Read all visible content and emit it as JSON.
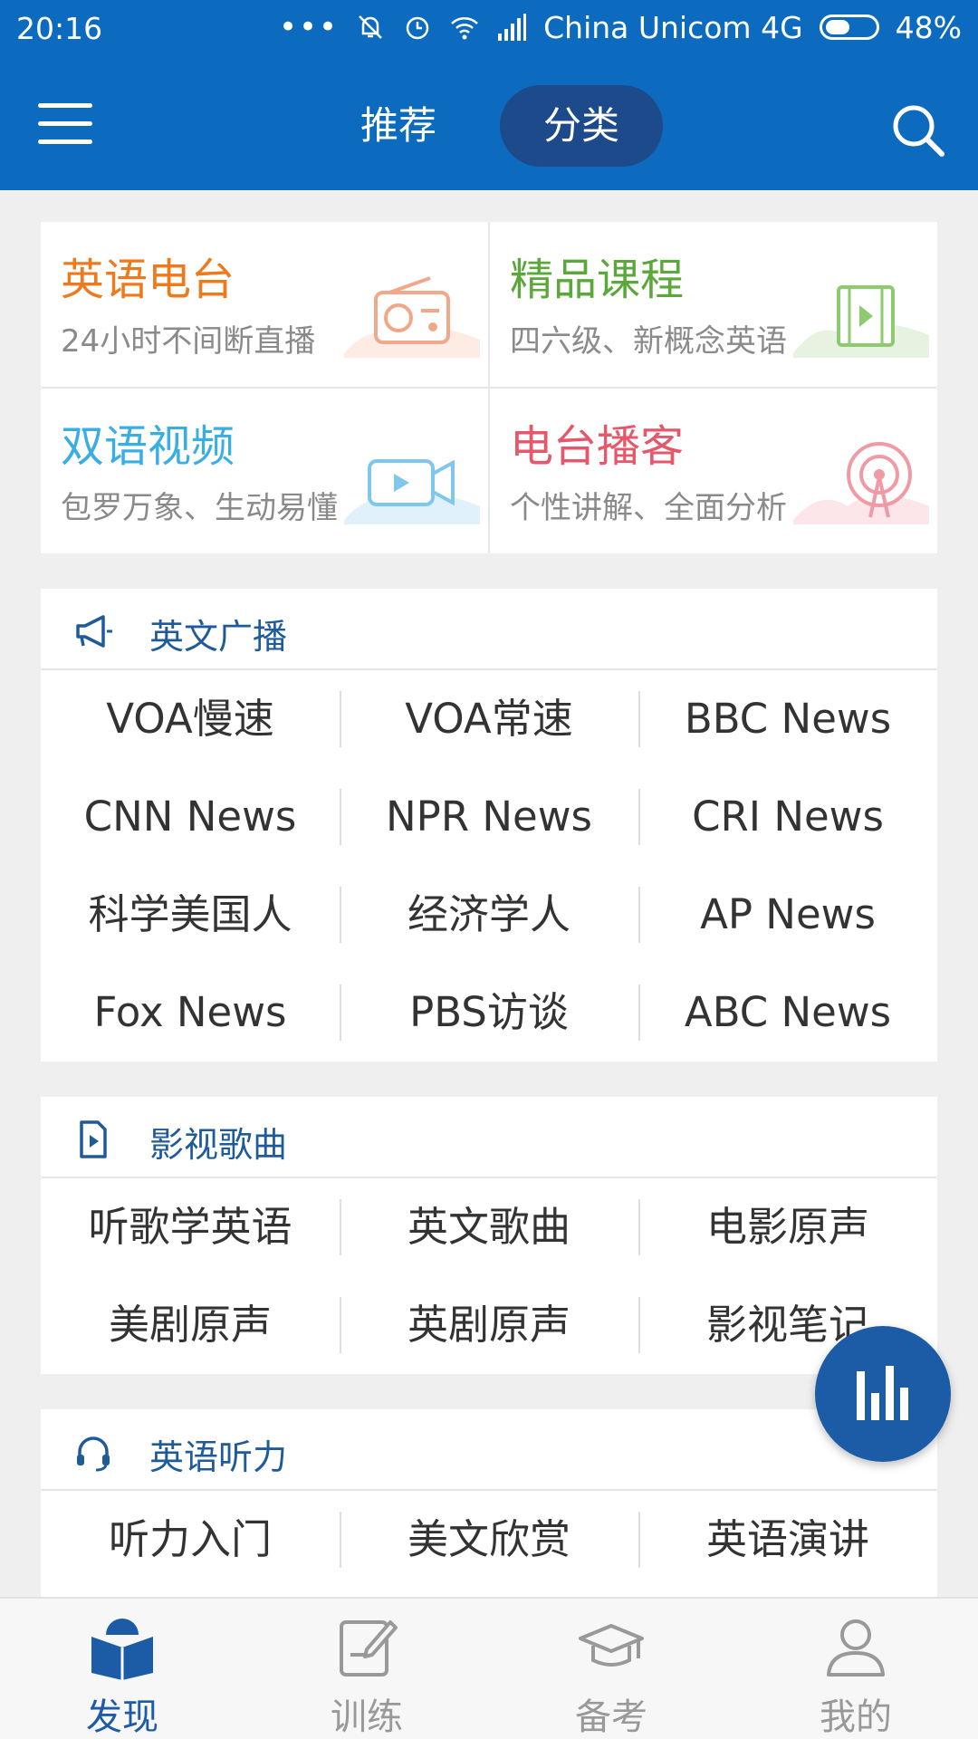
{
  "status_bar": {
    "time": "20:16",
    "carrier": "China Unicom 4G",
    "battery": "48%"
  },
  "header": {
    "tabs": [
      {
        "label": "推荐",
        "active": false
      },
      {
        "label": "分类",
        "active": true
      }
    ]
  },
  "cards": [
    {
      "title": "英语电台",
      "subtitle": "24小时不间断直播",
      "color": "#ee7a1e",
      "icon": "radio-icon"
    },
    {
      "title": "精品课程",
      "subtitle": "四六级、新概念英语",
      "color": "#5aa83a",
      "icon": "course-video-icon"
    },
    {
      "title": "双语视频",
      "subtitle": "包罗万象、生动易懂",
      "color": "#38aee2",
      "icon": "video-camera-icon"
    },
    {
      "title": "电台播客",
      "subtitle": "个性讲解、全面分析",
      "color": "#e5576a",
      "icon": "podcast-antenna-icon"
    }
  ],
  "sections": {
    "broadcast": {
      "title": "英文广播",
      "items": [
        "VOA慢速",
        "VOA常速",
        "BBC News",
        "CNN News",
        "NPR News",
        "CRI News",
        "科学美国人",
        "经济学人",
        "AP News",
        "Fox News",
        "PBS访谈",
        "ABC News"
      ]
    },
    "film": {
      "title": "影视歌曲",
      "items": [
        "听歌学英语",
        "英文歌曲",
        "电影原声",
        "美剧原声",
        "英剧原声",
        "影视笔记"
      ]
    },
    "listening": {
      "title": "英语听力",
      "items": [
        "听力入门",
        "美文欣赏",
        "英语演讲"
      ]
    }
  },
  "bottom_nav": [
    {
      "label": "发现",
      "active": true
    },
    {
      "label": "训练",
      "active": false
    },
    {
      "label": "备考",
      "active": false
    },
    {
      "label": "我的",
      "active": false
    }
  ],
  "colors": {
    "primary": "#0c6bbf",
    "active_tab_bg": "#1c4a8a",
    "fab": "#1c5ba6",
    "section_title": "#1f5a99"
  }
}
